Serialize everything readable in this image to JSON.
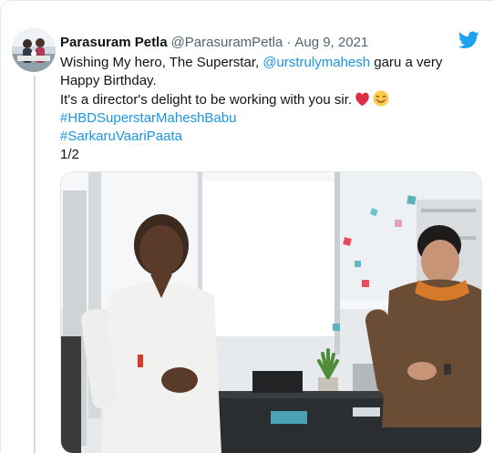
{
  "tweet": {
    "author": {
      "display_name": "Parasuram Petla",
      "handle": "@ParasuramPetla"
    },
    "separator": "·",
    "date": "Aug 9, 2021",
    "text": {
      "line1_prefix": "Wishing My hero, The Superstar, ",
      "mention": "@urstrulymahesh",
      "line1_suffix": " garu a very",
      "line2": "Happy Birthday.",
      "line3": "It's a director's delight to be working with you sir.",
      "hashtag1": "#HBDSuperstarMaheshBabu",
      "hashtag2": "#SarkaruVaariPaata",
      "thread_count": "1/2"
    },
    "icons": {
      "brand": "twitter-bird-icon",
      "emoji1": "red-heart-emoji",
      "emoji2": "smiling-face-emoji"
    },
    "colors": {
      "link": "#1b95e0",
      "twitter_blue": "#1da1f2",
      "secondary_text": "#536471"
    }
  }
}
